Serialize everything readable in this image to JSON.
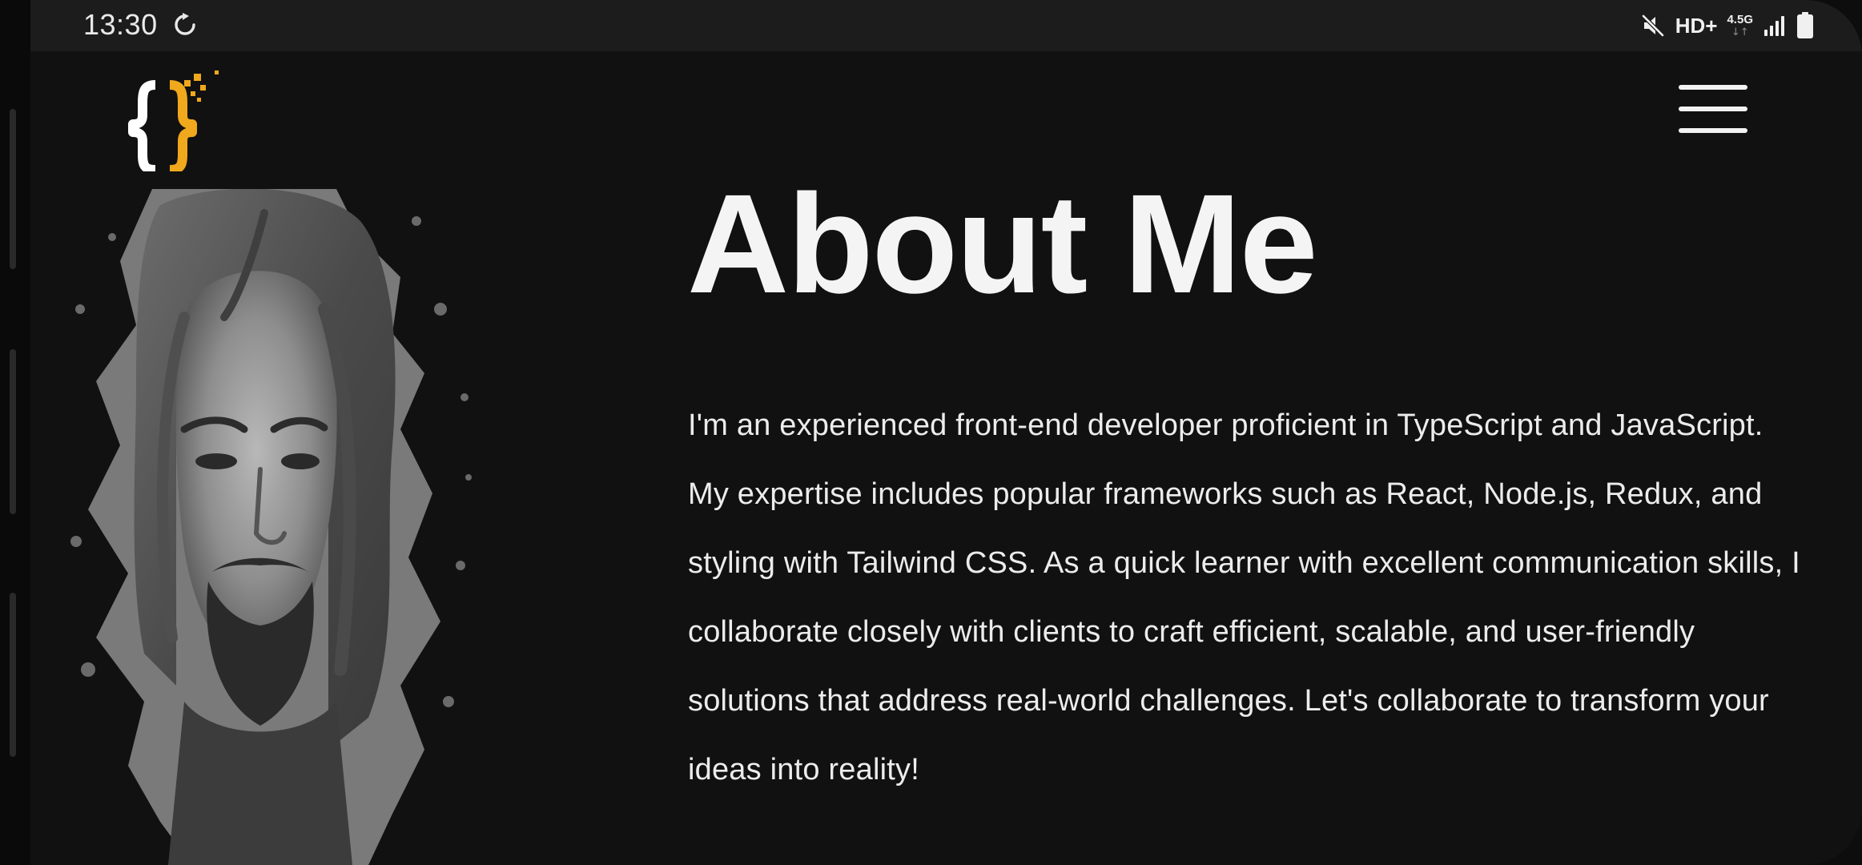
{
  "status_bar": {
    "time": "13:30",
    "sync_icon": "sync-icon",
    "mute_icon": "mute-icon",
    "hd_label": "HD+",
    "network_label": "4.5G",
    "signal_icon": "signal-icon",
    "battery_icon": "battery-icon"
  },
  "header": {
    "logo_icon": "curly-braces-logo",
    "menu_icon": "hamburger-menu-icon"
  },
  "about": {
    "title": "About Me",
    "portrait_icon": "portrait-image",
    "bio": "I'm an experienced front-end developer proficient in TypeScript and JavaScript. My expertise includes popular frameworks such as React, Node.js, Redux, and styling with Tailwind CSS. As a quick learner with excellent communication skills, I collaborate closely with clients to craft efficient, scalable, and user-friendly solutions that address real-world challenges. Let's collaborate to transform your ideas into reality!"
  },
  "colors": {
    "background": "#111111",
    "status_bar": "#1c1c1c",
    "accent": "#f0a81c",
    "text": "#f4f4f4"
  }
}
